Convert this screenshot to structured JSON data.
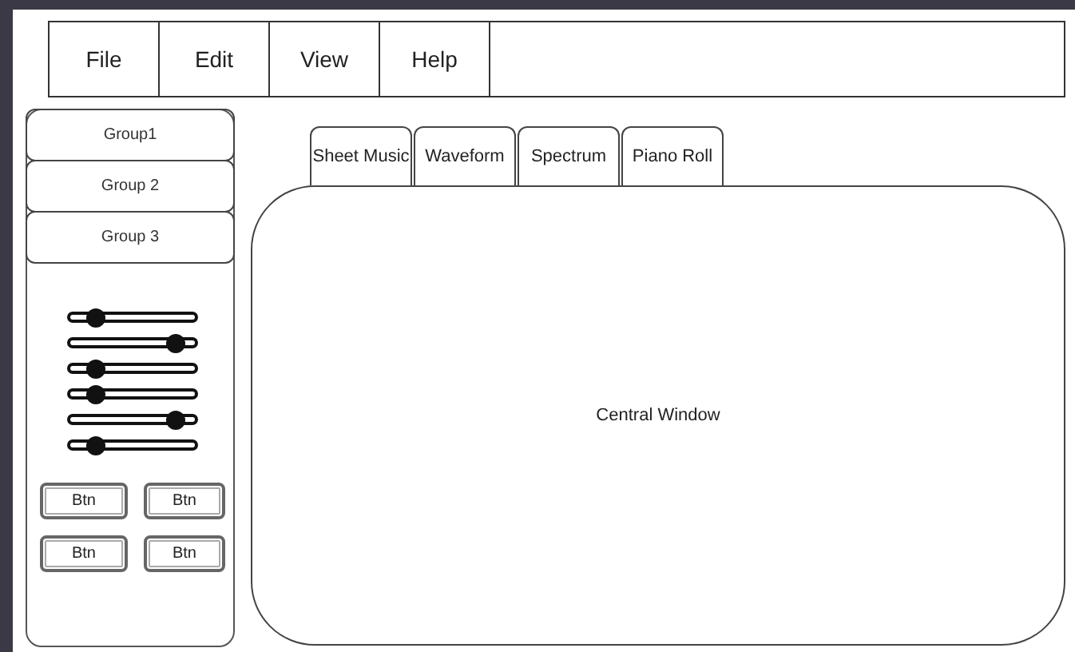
{
  "menu": [
    "File",
    "Edit",
    "View",
    "Help"
  ],
  "groups": [
    "Group1",
    "Group 2",
    "Group 3"
  ],
  "sliders": [
    {
      "level": 0.2
    },
    {
      "level": 0.85
    },
    {
      "level": 0.2
    },
    {
      "level": 0.2
    },
    {
      "level": 0.85
    },
    {
      "level": 0.2
    }
  ],
  "buttons": [
    "Btn",
    "Btn",
    "Btn",
    "Btn"
  ],
  "tabs": [
    "Sheet Music",
    "Waveform",
    "Spectrum",
    "Piano Roll"
  ],
  "central_window": {
    "label": "Central Window"
  }
}
